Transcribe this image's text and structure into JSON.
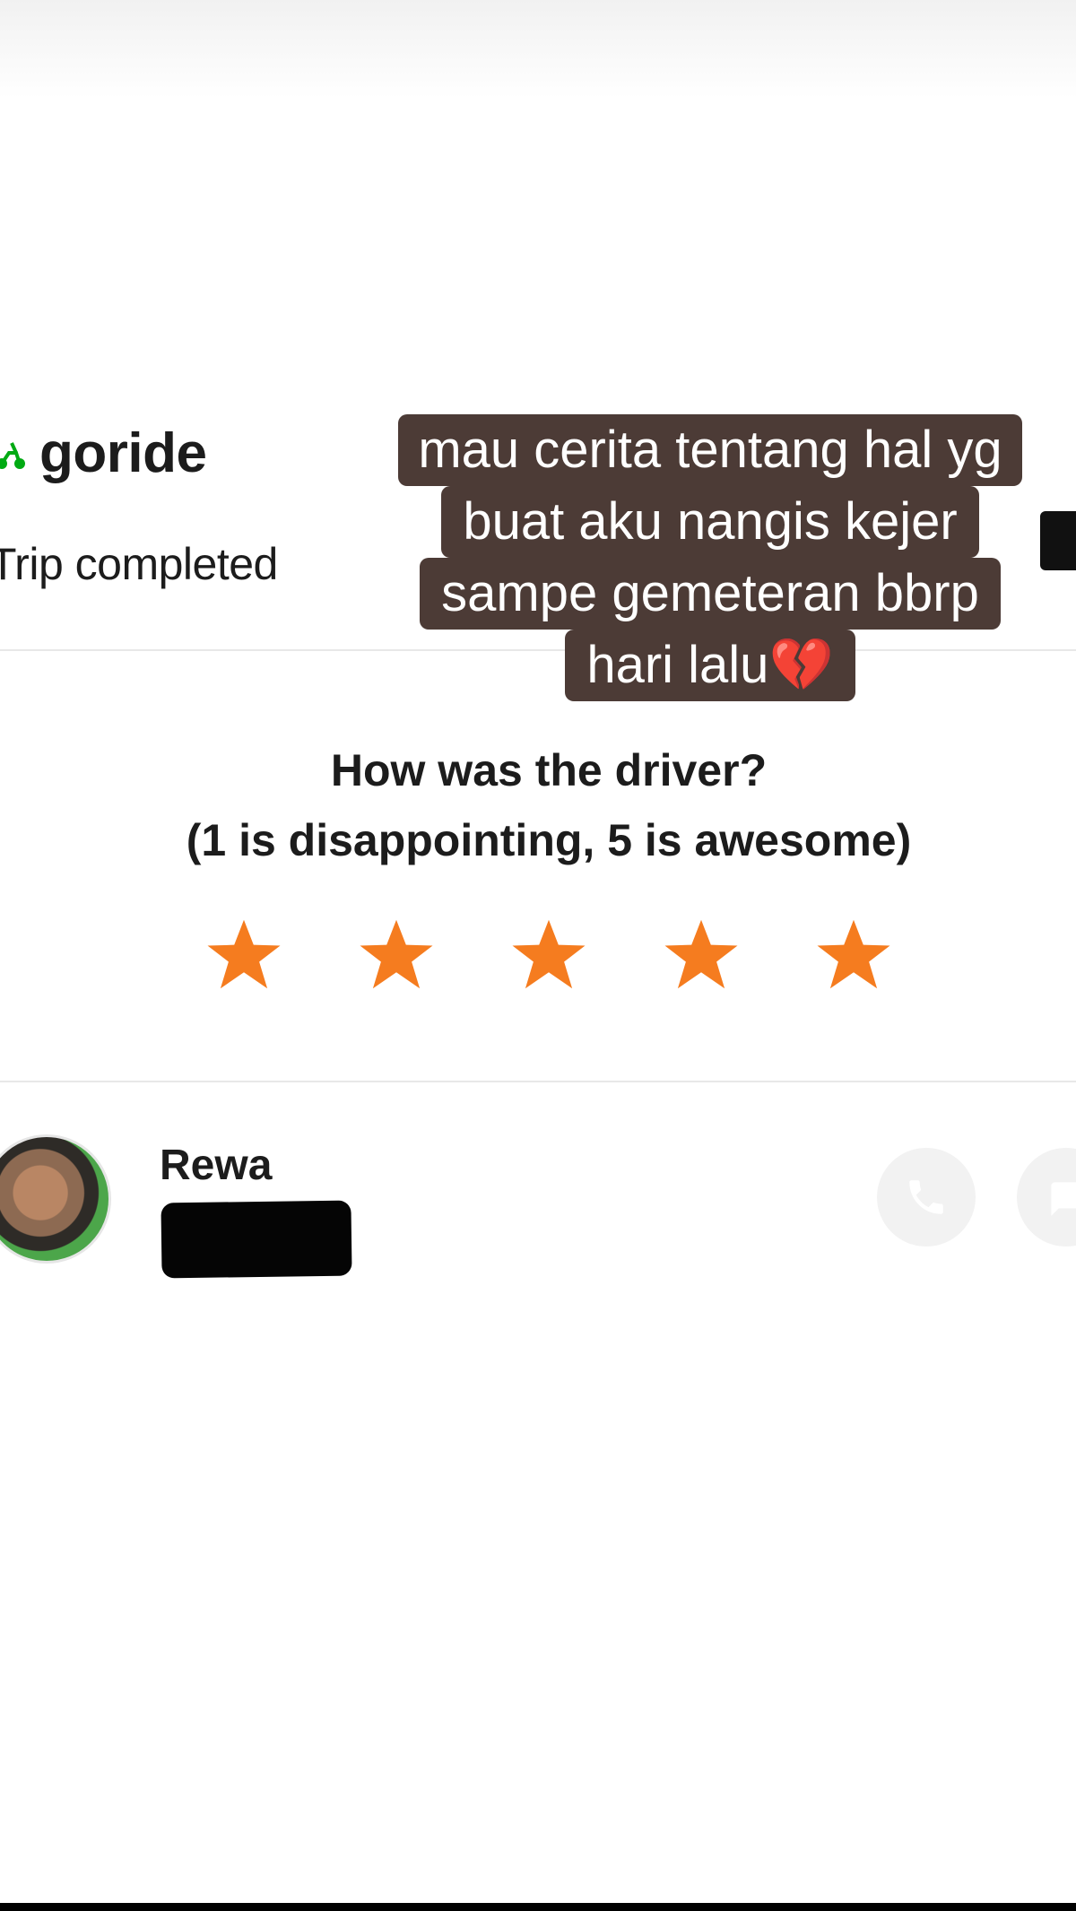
{
  "header": {
    "brand": "goride",
    "status": "Trip completed",
    "brand_color": "#00aa13"
  },
  "caption": {
    "lines": [
      "mau cerita tentang hal yg",
      "buat aku nangis kejer",
      "sampe gemeteran bbrp",
      "hari lalu"
    ],
    "emoji": "💔",
    "background_color": "#4c3b36"
  },
  "rating": {
    "question": "How was the driver?",
    "hint": "(1 is disappointing, 5 is awesome)",
    "stars_total": 5,
    "stars_selected": 5,
    "star_color": "#f57c1f"
  },
  "driver": {
    "name": "Rewa",
    "avatar_icon": "driver-photo",
    "actions": [
      "call-icon",
      "chat-icon"
    ]
  }
}
